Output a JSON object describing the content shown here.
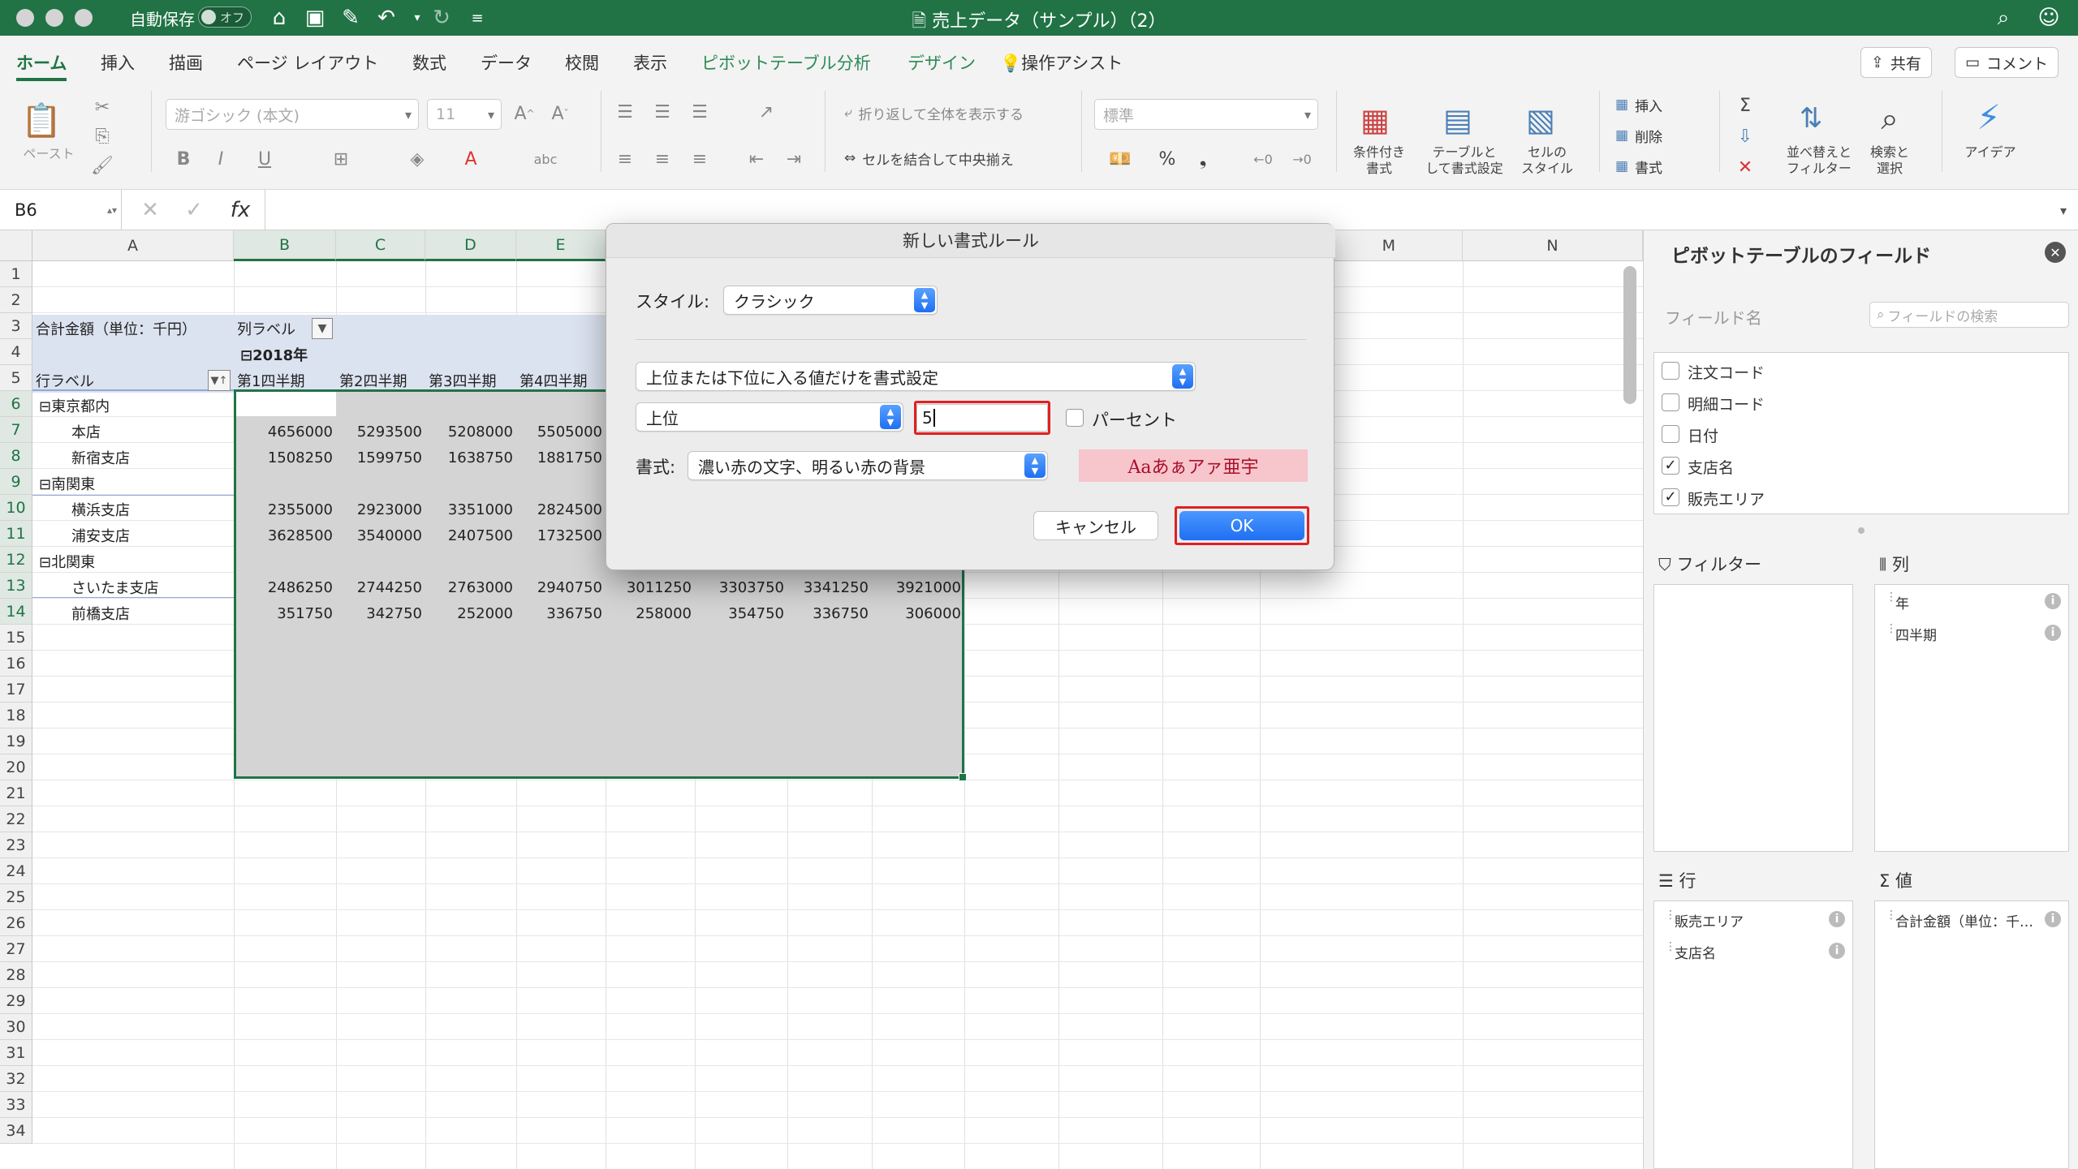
{
  "titlebar": {
    "autosave_label": "自動保存",
    "autosave_state": "オフ",
    "doc_title": "売上データ（サンプル）（2）"
  },
  "tabs": [
    "ホーム",
    "挿入",
    "描画",
    "ページ レイアウト",
    "数式",
    "データ",
    "校閲",
    "表示",
    "ピボットテーブル分析",
    "デザイン",
    "操作アシスト"
  ],
  "share": {
    "share_label": "共有",
    "comment_label": "コメント"
  },
  "ribbon": {
    "paste": "ペースト",
    "font_name": "游ゴシック (本文)",
    "font_size": "11",
    "wrap": "折り返して全体を表示する",
    "merge": "セルを結合して中央揃え",
    "number_format": "標準",
    "cond_format": "条件付き\n書式",
    "table_format": "テーブルと\nして書式設定",
    "cell_style": "セルの\nスタイル",
    "insert": "挿入",
    "delete": "削除",
    "format": "書式",
    "sort_filter": "並べ替えと\nフィルター",
    "find": "検索と\n選択",
    "ideas": "アイデア"
  },
  "formula": {
    "name_box": "B6",
    "fx": "fx"
  },
  "grid": {
    "columns": [
      "A",
      "B",
      "C",
      "D",
      "E",
      "M",
      "N"
    ],
    "rows": [
      "1",
      "2",
      "3",
      "4",
      "5",
      "6",
      "7",
      "8",
      "9",
      "10",
      "11",
      "12",
      "13",
      "14",
      "15",
      "16",
      "17",
      "18",
      "19",
      "20",
      "21",
      "22",
      "23",
      "24",
      "25",
      "26",
      "27",
      "28",
      "29",
      "30",
      "31",
      "32",
      "33",
      "34"
    ],
    "r3_a": "合計金額（単位：千円）",
    "r3_b": "列ラベル",
    "r4_year": "⊟2018年",
    "r5_a": "行ラベル",
    "quarters": [
      "第1四半期",
      "第2四半期",
      "第3四半期",
      "第4四半期"
    ],
    "labels": {
      "r6": "⊟東京都内",
      "r7": "本店",
      "r8": "新宿支店",
      "r9": "⊟南関東",
      "r10": "横浜支店",
      "r11": "浦安支店",
      "r12": "⊟北関東",
      "r13": "さいたま支店",
      "r14": "前橋支店"
    },
    "values": {
      "r7": [
        "4656000",
        "5293500",
        "5208000",
        "5505000"
      ],
      "r8": [
        "1508250",
        "1599750",
        "1638750",
        "1881750"
      ],
      "r10": [
        "2355000",
        "2923000",
        "3351000",
        "2824500"
      ],
      "r11": [
        "3628500",
        "3540000",
        "2407500",
        "1732500"
      ],
      "r13": [
        "2486250",
        "2744250",
        "2763000",
        "2940750",
        "3011250",
        "3303750",
        "3341250",
        "3921000"
      ],
      "r14": [
        "351750",
        "342750",
        "252000",
        "336750",
        "258000",
        "354750",
        "336750",
        "306000"
      ]
    }
  },
  "dialog": {
    "title": "新しい書式ルール",
    "style_label": "スタイル:",
    "style_value": "クラシック",
    "rule_type": "上位または下位に入る値だけを書式設定",
    "rank_value": "上位",
    "count_value": "5",
    "percent_label": "パーセント",
    "format_label": "書式:",
    "format_value": "濃い赤の文字、明るい赤の背景",
    "preview": "Aaあぁアァ亜宇",
    "cancel": "キャンセル",
    "ok": "OK"
  },
  "pane": {
    "title": "ピボットテーブルのフィールド",
    "field_name": "フィールド名",
    "search_placeholder": "フィールドの検索",
    "fields": [
      {
        "name": "注文コード",
        "checked": false
      },
      {
        "name": "明細コード",
        "checked": false
      },
      {
        "name": "日付",
        "checked": false
      },
      {
        "name": "支店名",
        "checked": true
      },
      {
        "name": "販売エリア",
        "checked": true
      }
    ],
    "filter_label": "フィルター",
    "columns_label": "列",
    "rows_label": "行",
    "values_label": "値",
    "columns_items": [
      "年",
      "四半期"
    ],
    "rows_items": [
      "販売エリア",
      "支店名"
    ],
    "values_items": [
      "合計金額（単位：千…"
    ]
  },
  "colors": {
    "excel_green": "#217346",
    "dialog_bg": "#ececec",
    "ok_blue": "#1f6ff2",
    "highlight_red": "#e02020",
    "preview_bg": "#f7c5cc",
    "preview_fg": "#a8102a"
  }
}
